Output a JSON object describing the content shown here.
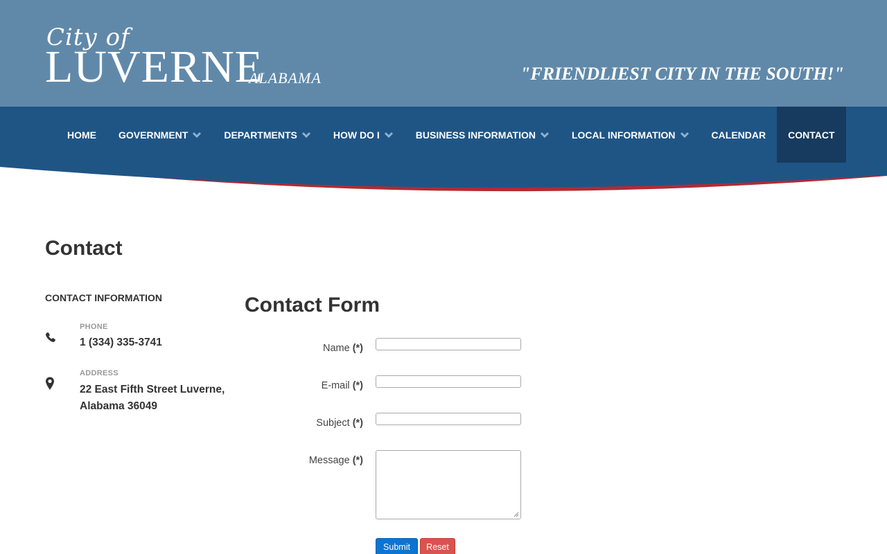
{
  "header": {
    "logo": {
      "city_of": "City of",
      "name": "LUVERNE",
      "state": "ALABAMA"
    },
    "tagline": "\"FRIENDLIEST CITY IN THE SOUTH!\""
  },
  "nav": {
    "items": [
      {
        "label": "HOME",
        "has_dropdown": false
      },
      {
        "label": "GOVERNMENT",
        "has_dropdown": true
      },
      {
        "label": "DEPARTMENTS",
        "has_dropdown": true
      },
      {
        "label": "HOW DO I",
        "has_dropdown": true
      },
      {
        "label": "BUSINESS INFORMATION",
        "has_dropdown": true
      },
      {
        "label": "LOCAL INFORMATION",
        "has_dropdown": true
      },
      {
        "label": "CALENDAR",
        "has_dropdown": false
      },
      {
        "label": "CONTACT",
        "has_dropdown": false,
        "active": true
      }
    ]
  },
  "page": {
    "title": "Contact"
  },
  "contact_info": {
    "heading": "CONTACT INFORMATION",
    "phone": {
      "label": "PHONE",
      "value": "1 (334) 335-3741",
      "icon": "phone-icon"
    },
    "address": {
      "label": "ADDRESS",
      "value": "22 East Fifth Street Luverne, Alabama 36049",
      "icon": "map-marker-icon"
    }
  },
  "form": {
    "title": "Contact Form",
    "required_mark": "(*)",
    "fields": [
      {
        "label": "Name",
        "value": ""
      },
      {
        "label": "E-mail",
        "value": ""
      },
      {
        "label": "Subject",
        "value": ""
      },
      {
        "label": "Message",
        "value": ""
      }
    ],
    "submit_label": "Submit",
    "reset_label": "Reset"
  },
  "colors": {
    "header_bg": "#6089a9",
    "nav_bg": "#1f5585",
    "nav_active": "#163b5f",
    "ribbon": "#b22a34",
    "submit": "#0d74d1",
    "reset": "#d9534f"
  }
}
